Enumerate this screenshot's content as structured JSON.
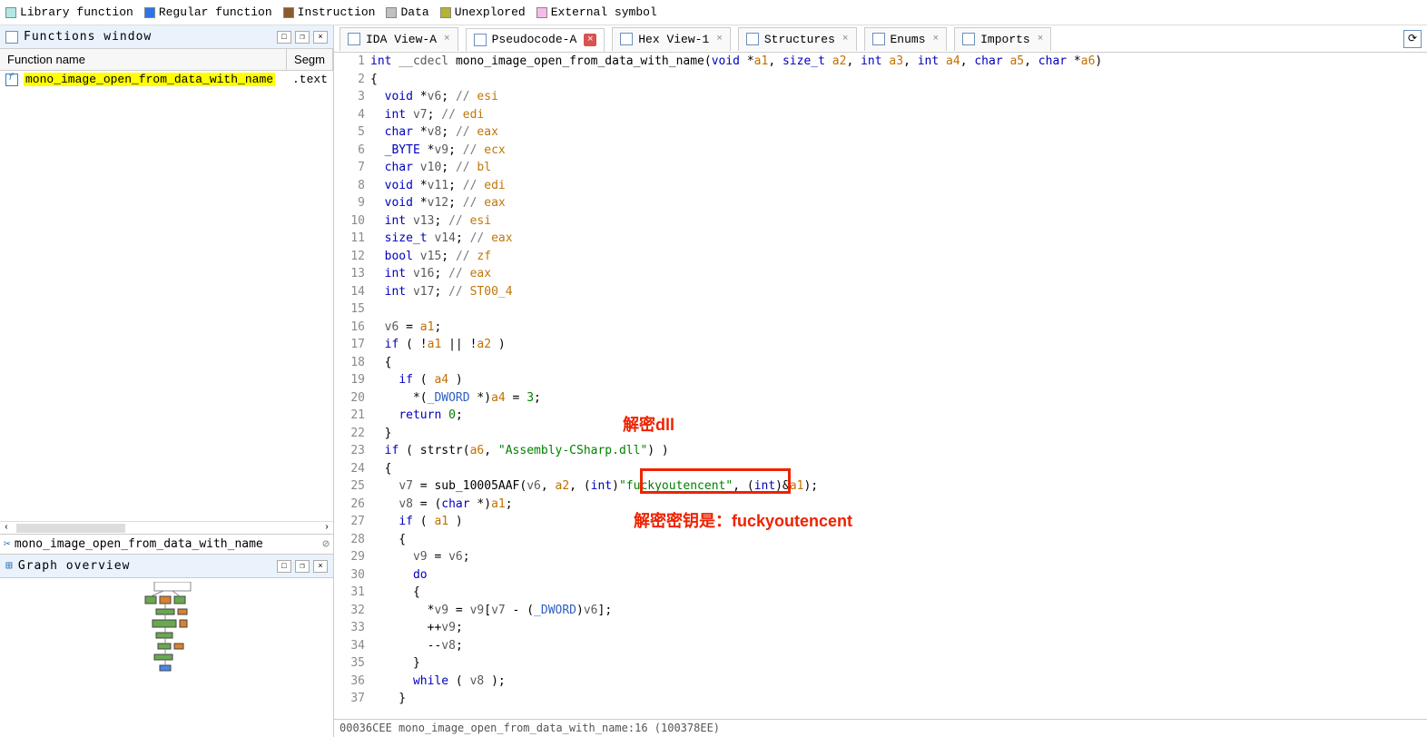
{
  "legend": [
    {
      "label": "Library function",
      "color": "#b2e8e4"
    },
    {
      "label": "Regular function",
      "color": "#2b74e8"
    },
    {
      "label": "Instruction",
      "color": "#8b5a2b"
    },
    {
      "label": "Data",
      "color": "#c0c0c0"
    },
    {
      "label": "Unexplored",
      "color": "#b3b334"
    },
    {
      "label": "External symbol",
      "color": "#f7bce6"
    }
  ],
  "functions_window": {
    "title": "Functions window",
    "col_name": "Function name",
    "col_seg": "Segm",
    "rows": [
      {
        "name": "mono_image_open_from_data_with_name",
        "segment": ".text"
      }
    ],
    "search_value": "mono_image_open_from_data_with_name"
  },
  "graph_overview": {
    "title": "Graph overview"
  },
  "tabs": [
    {
      "id": "ida-view-a",
      "label": "IDA View-A"
    },
    {
      "id": "pseudocode-a",
      "label": "Pseudocode-A",
      "active": true,
      "close_red": true
    },
    {
      "id": "hex-view-1",
      "label": "Hex View-1"
    },
    {
      "id": "structures",
      "label": "Structures"
    },
    {
      "id": "enums",
      "label": "Enums"
    },
    {
      "id": "imports",
      "label": "Imports"
    }
  ],
  "annotations": {
    "box_text": "\"fuckyoutencent\",",
    "label1": "解密dll",
    "label2": "解密密钥是：fuckyoutencent"
  },
  "code": {
    "lines": [
      {
        "n": 1,
        "bp": false,
        "segs": [
          {
            "t": "int",
            "c": "ty"
          },
          {
            "t": " __cdecl ",
            "c": "id"
          },
          {
            "t": "mono_image_open_from_data_with_name",
            "c": "fn"
          },
          {
            "t": "(",
            "c": "op"
          },
          {
            "t": "void",
            "c": "ty"
          },
          {
            "t": " *",
            "c": "op"
          },
          {
            "t": "a1",
            "c": "param"
          },
          {
            "t": ", ",
            "c": "op"
          },
          {
            "t": "size_t",
            "c": "ty"
          },
          {
            "t": " ",
            "c": "op"
          },
          {
            "t": "a2",
            "c": "param"
          },
          {
            "t": ", ",
            "c": "op"
          },
          {
            "t": "int",
            "c": "ty"
          },
          {
            "t": " ",
            "c": "op"
          },
          {
            "t": "a3",
            "c": "param"
          },
          {
            "t": ", ",
            "c": "op"
          },
          {
            "t": "int",
            "c": "ty"
          },
          {
            "t": " ",
            "c": "op"
          },
          {
            "t": "a4",
            "c": "param"
          },
          {
            "t": ", ",
            "c": "op"
          },
          {
            "t": "char",
            "c": "ty"
          },
          {
            "t": " ",
            "c": "op"
          },
          {
            "t": "a5",
            "c": "param"
          },
          {
            "t": ", ",
            "c": "op"
          },
          {
            "t": "char",
            "c": "ty"
          },
          {
            "t": " *",
            "c": "op"
          },
          {
            "t": "a6",
            "c": "param"
          },
          {
            "t": ")",
            "c": "op"
          }
        ]
      },
      {
        "n": 2,
        "bp": false,
        "segs": [
          {
            "t": "{",
            "c": "op"
          }
        ]
      },
      {
        "n": 3,
        "bp": false,
        "segs": [
          {
            "t": "  ",
            "c": "op"
          },
          {
            "t": "void",
            "c": "ty"
          },
          {
            "t": " *",
            "c": "op"
          },
          {
            "t": "v6",
            "c": "id"
          },
          {
            "t": "; ",
            "c": "op"
          },
          {
            "t": "// ",
            "c": "cmt"
          },
          {
            "t": "esi",
            "c": "reg"
          }
        ]
      },
      {
        "n": 4,
        "bp": false,
        "segs": [
          {
            "t": "  ",
            "c": "op"
          },
          {
            "t": "int",
            "c": "ty"
          },
          {
            "t": " ",
            "c": "op"
          },
          {
            "t": "v7",
            "c": "id"
          },
          {
            "t": "; ",
            "c": "op"
          },
          {
            "t": "// ",
            "c": "cmt"
          },
          {
            "t": "edi",
            "c": "reg"
          }
        ]
      },
      {
        "n": 5,
        "bp": false,
        "segs": [
          {
            "t": "  ",
            "c": "op"
          },
          {
            "t": "char",
            "c": "ty"
          },
          {
            "t": " *",
            "c": "op"
          },
          {
            "t": "v8",
            "c": "id"
          },
          {
            "t": "; ",
            "c": "op"
          },
          {
            "t": "// ",
            "c": "cmt"
          },
          {
            "t": "eax",
            "c": "reg"
          }
        ]
      },
      {
        "n": 6,
        "bp": false,
        "segs": [
          {
            "t": "  ",
            "c": "op"
          },
          {
            "t": "_BYTE",
            "c": "ty"
          },
          {
            "t": " *",
            "c": "op"
          },
          {
            "t": "v9",
            "c": "id"
          },
          {
            "t": "; ",
            "c": "op"
          },
          {
            "t": "// ",
            "c": "cmt"
          },
          {
            "t": "ecx",
            "c": "reg"
          }
        ]
      },
      {
        "n": 7,
        "bp": false,
        "segs": [
          {
            "t": "  ",
            "c": "op"
          },
          {
            "t": "char",
            "c": "ty"
          },
          {
            "t": " ",
            "c": "op"
          },
          {
            "t": "v10",
            "c": "id"
          },
          {
            "t": "; ",
            "c": "op"
          },
          {
            "t": "// ",
            "c": "cmt"
          },
          {
            "t": "bl",
            "c": "reg"
          }
        ]
      },
      {
        "n": 8,
        "bp": false,
        "segs": [
          {
            "t": "  ",
            "c": "op"
          },
          {
            "t": "void",
            "c": "ty"
          },
          {
            "t": " *",
            "c": "op"
          },
          {
            "t": "v11",
            "c": "id"
          },
          {
            "t": "; ",
            "c": "op"
          },
          {
            "t": "// ",
            "c": "cmt"
          },
          {
            "t": "edi",
            "c": "reg"
          }
        ]
      },
      {
        "n": 9,
        "bp": false,
        "segs": [
          {
            "t": "  ",
            "c": "op"
          },
          {
            "t": "void",
            "c": "ty"
          },
          {
            "t": " *",
            "c": "op"
          },
          {
            "t": "v12",
            "c": "id"
          },
          {
            "t": "; ",
            "c": "op"
          },
          {
            "t": "// ",
            "c": "cmt"
          },
          {
            "t": "eax",
            "c": "reg"
          }
        ]
      },
      {
        "n": 10,
        "bp": false,
        "segs": [
          {
            "t": "  ",
            "c": "op"
          },
          {
            "t": "int",
            "c": "ty"
          },
          {
            "t": " ",
            "c": "op"
          },
          {
            "t": "v13",
            "c": "id"
          },
          {
            "t": "; ",
            "c": "op"
          },
          {
            "t": "// ",
            "c": "cmt"
          },
          {
            "t": "esi",
            "c": "reg"
          }
        ]
      },
      {
        "n": 11,
        "bp": false,
        "segs": [
          {
            "t": "  ",
            "c": "op"
          },
          {
            "t": "size_t",
            "c": "ty"
          },
          {
            "t": " ",
            "c": "op"
          },
          {
            "t": "v14",
            "c": "id"
          },
          {
            "t": "; ",
            "c": "op"
          },
          {
            "t": "// ",
            "c": "cmt"
          },
          {
            "t": "eax",
            "c": "reg"
          }
        ]
      },
      {
        "n": 12,
        "bp": false,
        "segs": [
          {
            "t": "  ",
            "c": "op"
          },
          {
            "t": "bool",
            "c": "ty"
          },
          {
            "t": " ",
            "c": "op"
          },
          {
            "t": "v15",
            "c": "id"
          },
          {
            "t": "; ",
            "c": "op"
          },
          {
            "t": "// ",
            "c": "cmt"
          },
          {
            "t": "zf",
            "c": "reg"
          }
        ]
      },
      {
        "n": 13,
        "bp": false,
        "segs": [
          {
            "t": "  ",
            "c": "op"
          },
          {
            "t": "int",
            "c": "ty"
          },
          {
            "t": " ",
            "c": "op"
          },
          {
            "t": "v16",
            "c": "id"
          },
          {
            "t": "; ",
            "c": "op"
          },
          {
            "t": "// ",
            "c": "cmt"
          },
          {
            "t": "eax",
            "c": "reg"
          }
        ]
      },
      {
        "n": 14,
        "bp": false,
        "segs": [
          {
            "t": "  ",
            "c": "op"
          },
          {
            "t": "int",
            "c": "ty"
          },
          {
            "t": " ",
            "c": "op"
          },
          {
            "t": "v17",
            "c": "id"
          },
          {
            "t": "; ",
            "c": "op"
          },
          {
            "t": "// ",
            "c": "cmt"
          },
          {
            "t": "ST00_4",
            "c": "reg"
          }
        ]
      },
      {
        "n": 15,
        "bp": false,
        "segs": []
      },
      {
        "n": 16,
        "bp": true,
        "segs": [
          {
            "t": "  ",
            "c": "op"
          },
          {
            "t": "v6",
            "c": "id"
          },
          {
            "t": " = ",
            "c": "op"
          },
          {
            "t": "a1",
            "c": "param"
          },
          {
            "t": ";",
            "c": "op"
          }
        ]
      },
      {
        "n": 17,
        "bp": true,
        "segs": [
          {
            "t": "  ",
            "c": "op"
          },
          {
            "t": "if",
            "c": "kw"
          },
          {
            "t": " ( !",
            "c": "op"
          },
          {
            "t": "a1",
            "c": "param"
          },
          {
            "t": " || !",
            "c": "op"
          },
          {
            "t": "a2",
            "c": "param"
          },
          {
            "t": " )",
            "c": "op"
          }
        ]
      },
      {
        "n": 18,
        "bp": false,
        "segs": [
          {
            "t": "  {",
            "c": "op"
          }
        ]
      },
      {
        "n": 19,
        "bp": true,
        "segs": [
          {
            "t": "    ",
            "c": "op"
          },
          {
            "t": "if",
            "c": "kw"
          },
          {
            "t": " ( ",
            "c": "op"
          },
          {
            "t": "a4",
            "c": "param"
          },
          {
            "t": " )",
            "c": "op"
          }
        ]
      },
      {
        "n": 20,
        "bp": true,
        "segs": [
          {
            "t": "      *(",
            "c": "op"
          },
          {
            "t": "_DWORD",
            "c": "ptr"
          },
          {
            "t": " *)",
            "c": "op"
          },
          {
            "t": "a4",
            "c": "param"
          },
          {
            "t": " = ",
            "c": "op"
          },
          {
            "t": "3",
            "c": "num"
          },
          {
            "t": ";",
            "c": "op"
          }
        ]
      },
      {
        "n": 21,
        "bp": true,
        "segs": [
          {
            "t": "    ",
            "c": "op"
          },
          {
            "t": "return",
            "c": "kw"
          },
          {
            "t": " ",
            "c": "op"
          },
          {
            "t": "0",
            "c": "num"
          },
          {
            "t": ";",
            "c": "op"
          }
        ]
      },
      {
        "n": 22,
        "bp": false,
        "segs": [
          {
            "t": "  }",
            "c": "op"
          }
        ]
      },
      {
        "n": 23,
        "bp": true,
        "segs": [
          {
            "t": "  ",
            "c": "op"
          },
          {
            "t": "if",
            "c": "kw"
          },
          {
            "t": " ( ",
            "c": "op"
          },
          {
            "t": "strstr",
            "c": "fn"
          },
          {
            "t": "(",
            "c": "op"
          },
          {
            "t": "a6",
            "c": "param"
          },
          {
            "t": ", ",
            "c": "op"
          },
          {
            "t": "\"Assembly-CSharp.dll\"",
            "c": "str"
          },
          {
            "t": ") )",
            "c": "op"
          }
        ]
      },
      {
        "n": 24,
        "bp": false,
        "segs": [
          {
            "t": "  {",
            "c": "op"
          }
        ]
      },
      {
        "n": 25,
        "bp": true,
        "segs": [
          {
            "t": "    ",
            "c": "op"
          },
          {
            "t": "v7",
            "c": "id"
          },
          {
            "t": " = ",
            "c": "op"
          },
          {
            "t": "sub_10005AAF",
            "c": "fn"
          },
          {
            "t": "(",
            "c": "op"
          },
          {
            "t": "v6",
            "c": "id"
          },
          {
            "t": ", ",
            "c": "op"
          },
          {
            "t": "a2",
            "c": "param"
          },
          {
            "t": ", (",
            "c": "op"
          },
          {
            "t": "int",
            "c": "ty"
          },
          {
            "t": ")",
            "c": "op"
          },
          {
            "t": "\"fuckyoutencent\"",
            "c": "str"
          },
          {
            "t": ", ",
            "c": "op"
          },
          {
            "t": "(",
            "c": "op"
          },
          {
            "t": "int",
            "c": "ty"
          },
          {
            "t": ")&",
            "c": "op"
          },
          {
            "t": "a1",
            "c": "param"
          },
          {
            "t": ");",
            "c": "op"
          }
        ]
      },
      {
        "n": 26,
        "bp": true,
        "segs": [
          {
            "t": "    ",
            "c": "op"
          },
          {
            "t": "v8",
            "c": "id"
          },
          {
            "t": " = (",
            "c": "op"
          },
          {
            "t": "char",
            "c": "ty"
          },
          {
            "t": " *)",
            "c": "op"
          },
          {
            "t": "a1",
            "c": "param"
          },
          {
            "t": ";",
            "c": "op"
          }
        ]
      },
      {
        "n": 27,
        "bp": true,
        "segs": [
          {
            "t": "    ",
            "c": "op"
          },
          {
            "t": "if",
            "c": "kw"
          },
          {
            "t": " ( ",
            "c": "op"
          },
          {
            "t": "a1",
            "c": "param"
          },
          {
            "t": " )",
            "c": "op"
          }
        ]
      },
      {
        "n": 28,
        "bp": false,
        "segs": [
          {
            "t": "    {",
            "c": "op"
          }
        ]
      },
      {
        "n": 29,
        "bp": true,
        "segs": [
          {
            "t": "      ",
            "c": "op"
          },
          {
            "t": "v9",
            "c": "id"
          },
          {
            "t": " = ",
            "c": "op"
          },
          {
            "t": "v6",
            "c": "id"
          },
          {
            "t": ";",
            "c": "op"
          }
        ]
      },
      {
        "n": 30,
        "bp": false,
        "segs": [
          {
            "t": "      ",
            "c": "op"
          },
          {
            "t": "do",
            "c": "kw"
          }
        ]
      },
      {
        "n": 31,
        "bp": false,
        "segs": [
          {
            "t": "      {",
            "c": "op"
          }
        ]
      },
      {
        "n": 32,
        "bp": true,
        "segs": [
          {
            "t": "        *",
            "c": "op"
          },
          {
            "t": "v9",
            "c": "id"
          },
          {
            "t": " = ",
            "c": "op"
          },
          {
            "t": "v9",
            "c": "id"
          },
          {
            "t": "[",
            "c": "op"
          },
          {
            "t": "v7",
            "c": "id"
          },
          {
            "t": " - (",
            "c": "op"
          },
          {
            "t": "_DWORD",
            "c": "ptr"
          },
          {
            "t": ")",
            "c": "op"
          },
          {
            "t": "v6",
            "c": "id"
          },
          {
            "t": "];",
            "c": "op"
          }
        ]
      },
      {
        "n": 33,
        "bp": true,
        "segs": [
          {
            "t": "        ++",
            "c": "op"
          },
          {
            "t": "v9",
            "c": "id"
          },
          {
            "t": ";",
            "c": "op"
          }
        ]
      },
      {
        "n": 34,
        "bp": true,
        "segs": [
          {
            "t": "        --",
            "c": "op"
          },
          {
            "t": "v8",
            "c": "id"
          },
          {
            "t": ";",
            "c": "op"
          }
        ]
      },
      {
        "n": 35,
        "bp": false,
        "segs": [
          {
            "t": "      }",
            "c": "op"
          }
        ]
      },
      {
        "n": 36,
        "bp": true,
        "segs": [
          {
            "t": "      ",
            "c": "op"
          },
          {
            "t": "while",
            "c": "kw"
          },
          {
            "t": " ( ",
            "c": "op"
          },
          {
            "t": "v8",
            "c": "id"
          },
          {
            "t": " );",
            "c": "op"
          }
        ]
      },
      {
        "n": 37,
        "bp": false,
        "segs": [
          {
            "t": "    }",
            "c": "op"
          }
        ]
      }
    ]
  },
  "status": "00036CEE mono_image_open_from_data_with_name:16 (100378EE)"
}
